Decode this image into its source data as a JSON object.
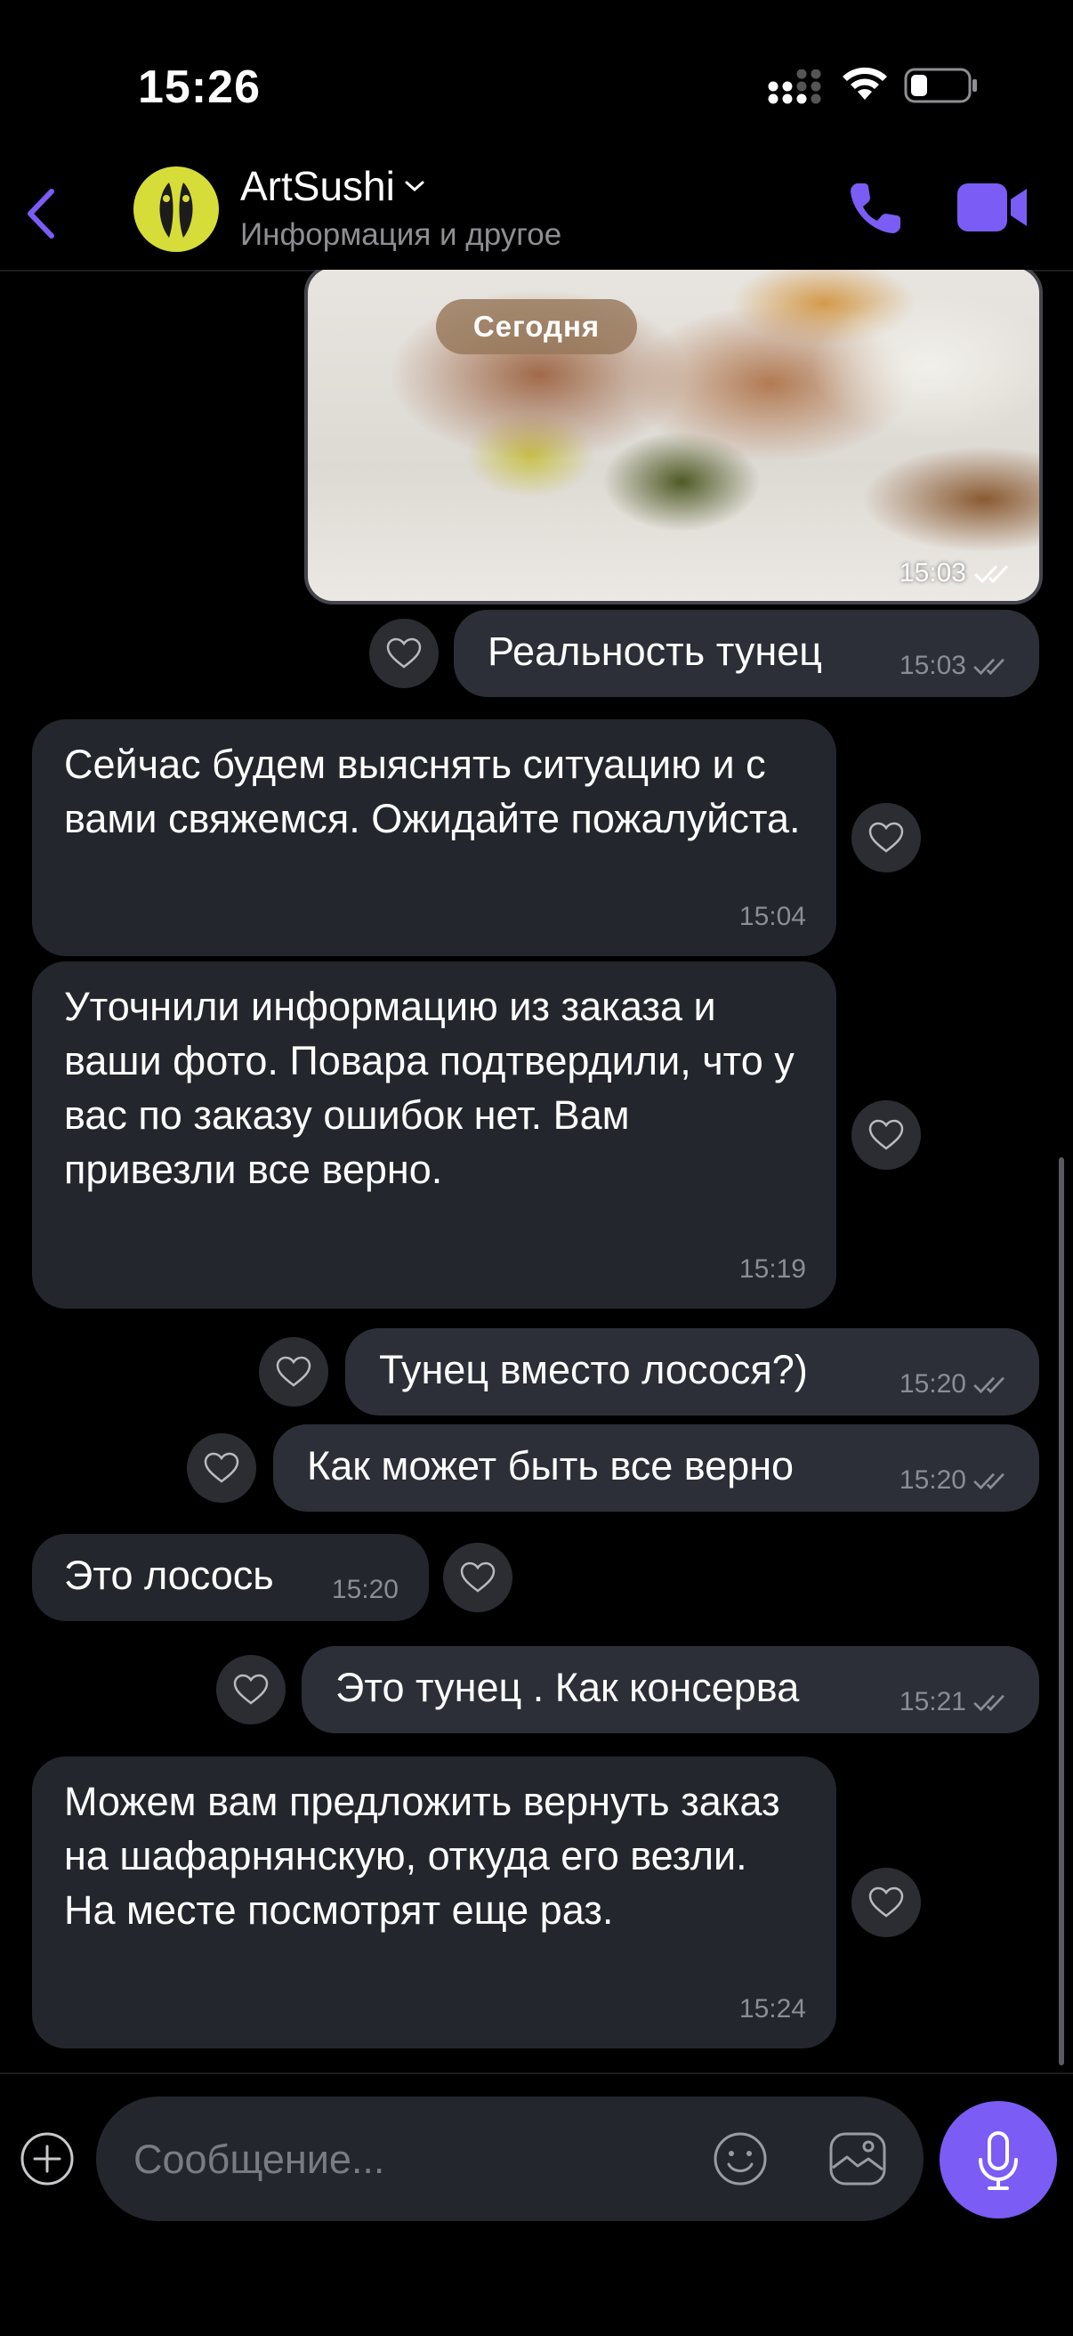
{
  "status_bar": {
    "time": "15:26"
  },
  "header": {
    "contact_name": "ArtSushi",
    "contact_subtitle": "Информация и другое"
  },
  "chat": {
    "date_separator": "Сегодня",
    "photo_time": "15:03",
    "messages": [
      {
        "direction": "out",
        "text": "Реальность тунец",
        "time": "15:03"
      },
      {
        "direction": "in",
        "text": "Сейчас будем выяснять ситуацию и с вами свяжемся. Ожидайте пожалуйста.",
        "time": "15:04"
      },
      {
        "direction": "in",
        "text": "Уточнили информацию из заказа и ваши фото. Повара подтвердили, что у вас по заказу ошибок нет. Вам привезли все верно.",
        "time": "15:19"
      },
      {
        "direction": "out",
        "text": "Тунец вместо лосося?)",
        "time": "15:20"
      },
      {
        "direction": "out",
        "text": "Как может быть все верно",
        "time": "15:20"
      },
      {
        "direction": "in",
        "text": "Это лосось",
        "time": "15:20"
      },
      {
        "direction": "out",
        "text": "Это тунец . Как консерва",
        "time": "15:21"
      },
      {
        "direction": "in",
        "text": "Можем вам предложить вернуть заказ  на шафарнянскую, откуда его везли. На месте посмотрят еще раз.",
        "time": "15:24"
      }
    ]
  },
  "composer": {
    "placeholder": "Сообщение..."
  },
  "colors": {
    "accent": "#7b5cf5",
    "outgoing_bubble": "#2c2f38",
    "incoming_bubble": "#24262d",
    "avatar_bg": "#d6dd38"
  }
}
